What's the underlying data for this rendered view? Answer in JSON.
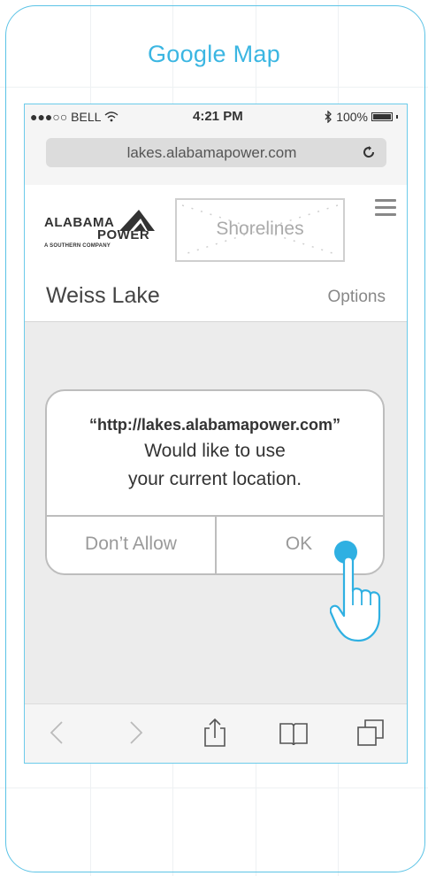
{
  "frame": {
    "title": "Google Map"
  },
  "status_bar": {
    "carrier": "●●●○○ BELL",
    "time": "4:21 PM",
    "battery": "100%"
  },
  "browser": {
    "url": "lakes.alabamapower.com"
  },
  "site": {
    "logo_line1": "ALABAMA",
    "logo_line2": "POWER",
    "logo_line3": "A SOUTHERN COMPANY",
    "placeholder_label": "Shorelines",
    "lake_name": "Weiss Lake",
    "options_label": "Options"
  },
  "alert": {
    "url": "“http://lakes.alabamapower.com”",
    "line1": "Would like to use",
    "line2": "your current location.",
    "dont_allow": "Don’t Allow",
    "ok": "OK"
  },
  "toolbar_icons": [
    "back-icon",
    "forward-icon",
    "share-icon",
    "bookmarks-icon",
    "tabs-icon"
  ],
  "colors": {
    "accent": "#3bb6e2",
    "frame": "#5bc3e6",
    "screen_bg": "#ececec"
  }
}
